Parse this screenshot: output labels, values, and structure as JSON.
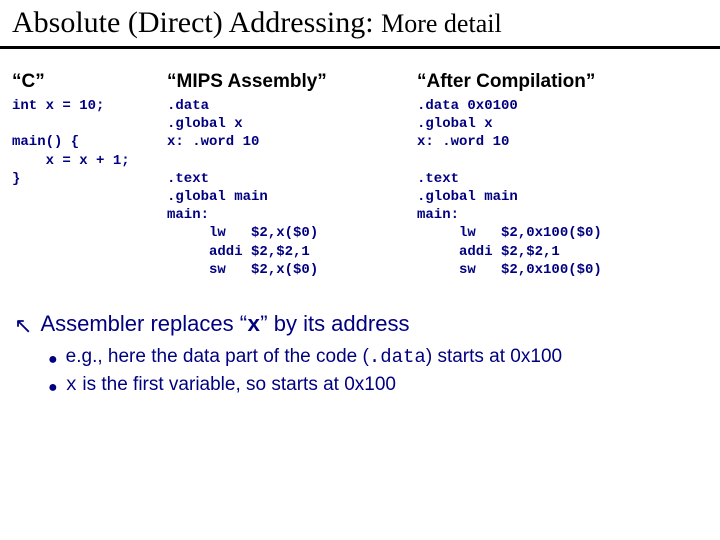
{
  "title_main": "Absolute (Direct) Addressing: ",
  "title_sub": "More detail",
  "columns": {
    "c": {
      "header": "“C”",
      "code": "int x = 10;\n\nmain() {\n    x = x + 1;\n}"
    },
    "mips": {
      "header": "“MIPS Assembly”",
      "code": ".data\n.global x\nx: .word 10\n\n.text\n.global main\nmain:\n     lw   $2,x($0)\n     addi $2,$2,1\n     sw   $2,x($0)"
    },
    "after": {
      "header": "“After Compilation”",
      "code": ".data 0x0100\n.global x\nx: .word 10\n\n.text\n.global main\nmain:\n     lw   $2,0x100($0)\n     addi $2,$2,1\n     sw   $2,0x100($0)"
    }
  },
  "notes": {
    "line1_pre": "Assembler replaces “",
    "line1_x": "x",
    "line1_post": "” by its address",
    "sub1_pre": "e.g., here the data part of the code (",
    "sub1_code": ".data",
    "sub1_post": ") starts at 0x100",
    "sub2_code": "x",
    "sub2_post": " is the first variable, so starts at 0x100"
  }
}
